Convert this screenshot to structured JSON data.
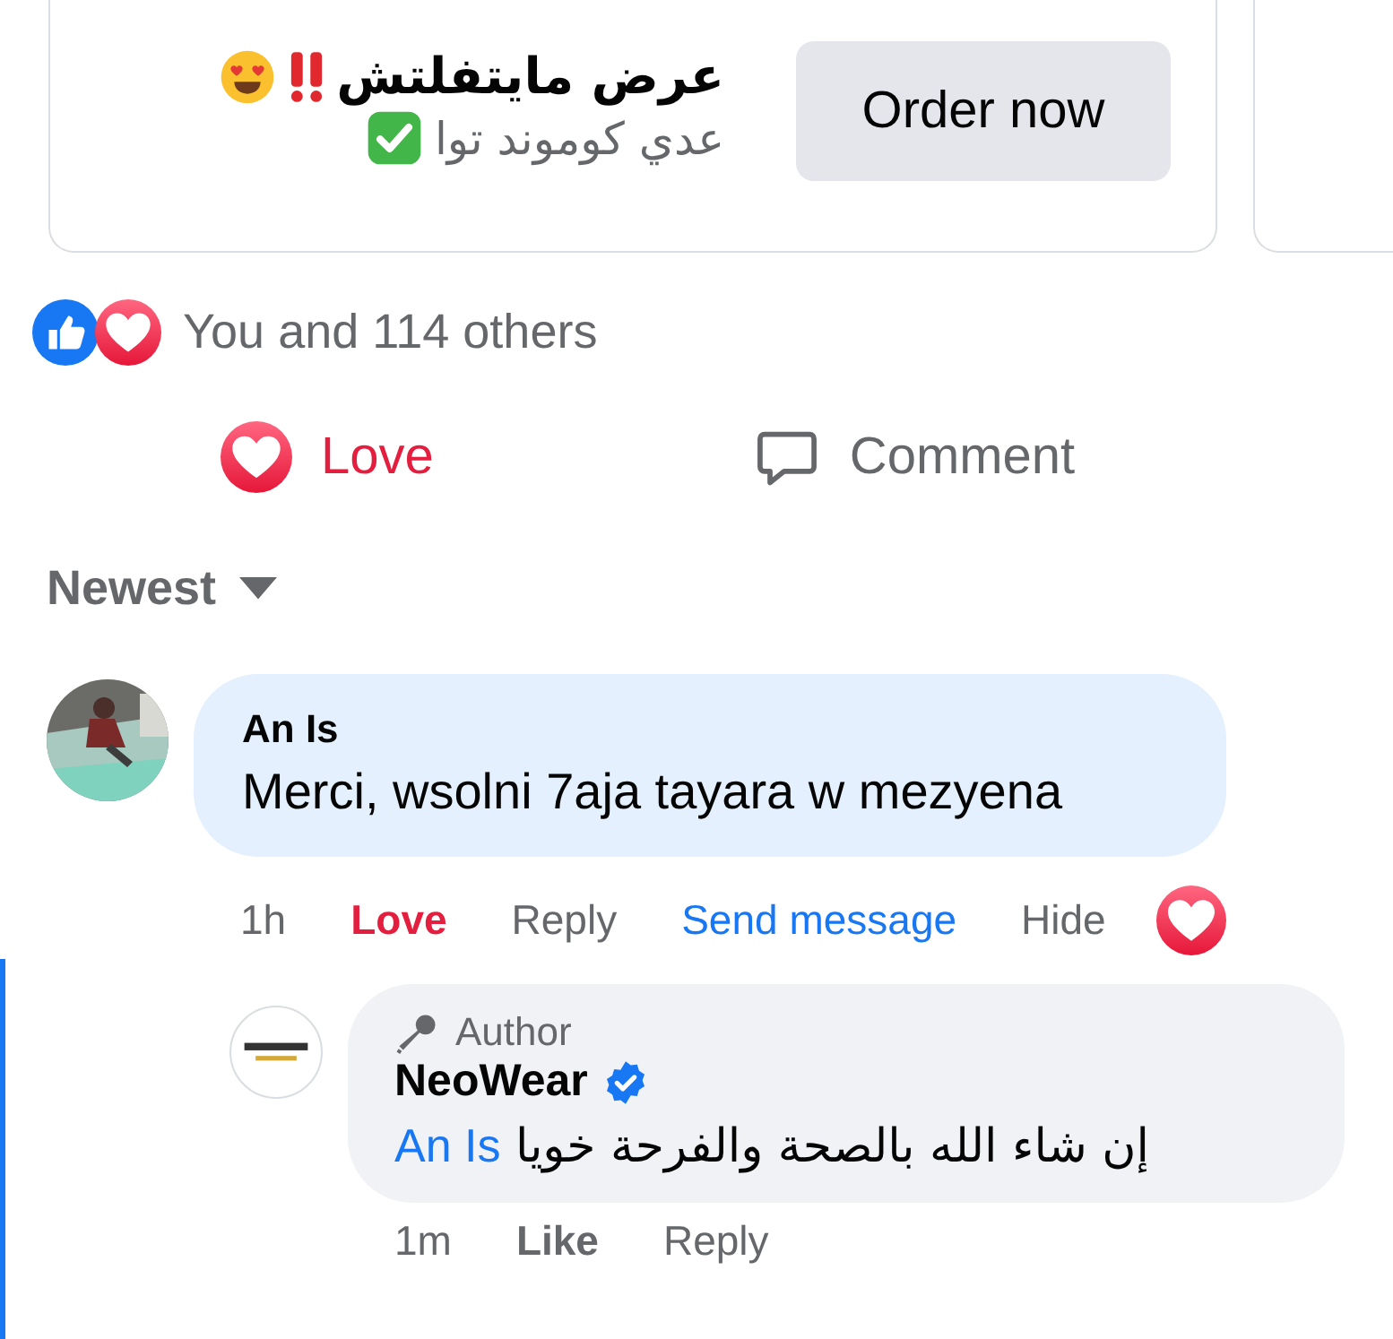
{
  "ad_cards": [
    {
      "kind": "offer",
      "title": "عرض مايتفلتش",
      "subtitle": "عدي كوموند توا",
      "button": "Order now"
    },
    {
      "kind": "partial"
    }
  ],
  "reaction_summary": {
    "reactions": [
      {
        "kind": "like"
      },
      {
        "kind": "love"
      }
    ],
    "text": "You and 114 others"
  },
  "post_actions": [
    {
      "kind": "love",
      "label": "Love",
      "active": true
    },
    {
      "kind": "comment",
      "label": "Comment",
      "active": false
    }
  ],
  "sort": {
    "label": "Newest"
  },
  "comment": {
    "author": "An Is",
    "text": "Merci, wsolni 7aja tayara w mezyena",
    "actions": [
      {
        "kind": "time",
        "label": "1h"
      },
      {
        "kind": "react",
        "label": "Love",
        "active": true
      },
      {
        "kind": "plain",
        "label": "Reply"
      },
      {
        "kind": "link",
        "label": "Send message"
      },
      {
        "kind": "plain",
        "label": "Hide"
      }
    ],
    "reaction": {
      "kind": "love"
    },
    "reply": {
      "badge": "Author",
      "author": "NeoWear",
      "verified": true,
      "mention": "An Is",
      "text": "إن شاء الله بالصحة والفرحة خويا",
      "actions": [
        {
          "kind": "time",
          "label": "1m"
        },
        {
          "kind": "react",
          "label": "Like",
          "active": false
        },
        {
          "kind": "plain",
          "label": "Reply"
        }
      ]
    }
  }
}
